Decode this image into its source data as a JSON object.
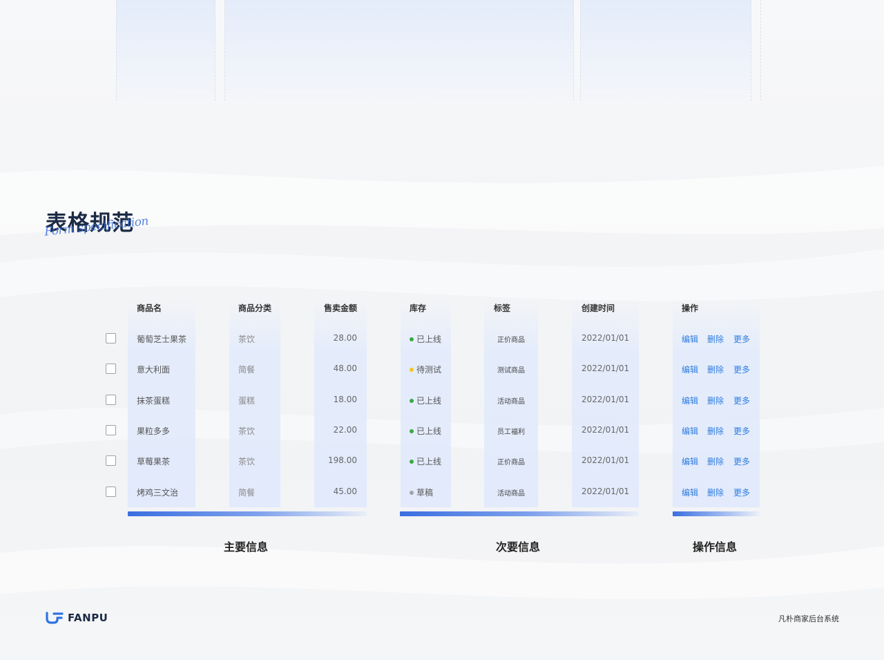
{
  "page": {
    "title": "表格规范",
    "title_script": "Form specification"
  },
  "table": {
    "headers": [
      "商品名",
      "商品分类",
      "售卖金额",
      "库存",
      "标签",
      "创建时间",
      "操作"
    ],
    "rows": [
      {
        "name": "葡萄芝士果茶",
        "category": "茶饮",
        "amount": "28.00",
        "status": "已上线",
        "status_color": "#3aa845",
        "tag": "正价商品",
        "date": "2022/01/01"
      },
      {
        "name": "意大利面",
        "category": "简餐",
        "amount": "48.00",
        "status": "待测试",
        "status_color": "#f2c522",
        "tag": "测试商品",
        "date": "2022/01/01"
      },
      {
        "name": "抹茶蛋糕",
        "category": "蛋糕",
        "amount": "18.00",
        "status": "已上线",
        "status_color": "#3aa845",
        "tag": "活动商品",
        "date": "2022/01/01"
      },
      {
        "name": "果粒多多",
        "category": "茶饮",
        "amount": "22.00",
        "status": "已上线",
        "status_color": "#3aa845",
        "tag": "员工福利",
        "date": "2022/01/01"
      },
      {
        "name": "草莓果茶",
        "category": "茶饮",
        "amount": "198.00",
        "status": "已上线",
        "status_color": "#3aa845",
        "tag": "正价商品",
        "date": "2022/01/01"
      },
      {
        "name": "烤鸡三文治",
        "category": "简餐",
        "amount": "45.00",
        "status": "草稿",
        "status_color": "#a0a4aa",
        "tag": "活动商品",
        "date": "2022/01/01"
      }
    ],
    "actions": {
      "edit": "编辑",
      "delete": "删除",
      "more": "更多"
    }
  },
  "sections": {
    "primary": "主要信息",
    "secondary": "次要信息",
    "actions": "操作信息"
  },
  "footer": {
    "brand": "FANPU",
    "system_name": "凡朴商家后台系统"
  },
  "colors": {
    "accent": "#3a6fe0",
    "link": "#2f7de1",
    "online": "#3aa845",
    "testing": "#f2c522",
    "draft": "#a0a4aa"
  }
}
